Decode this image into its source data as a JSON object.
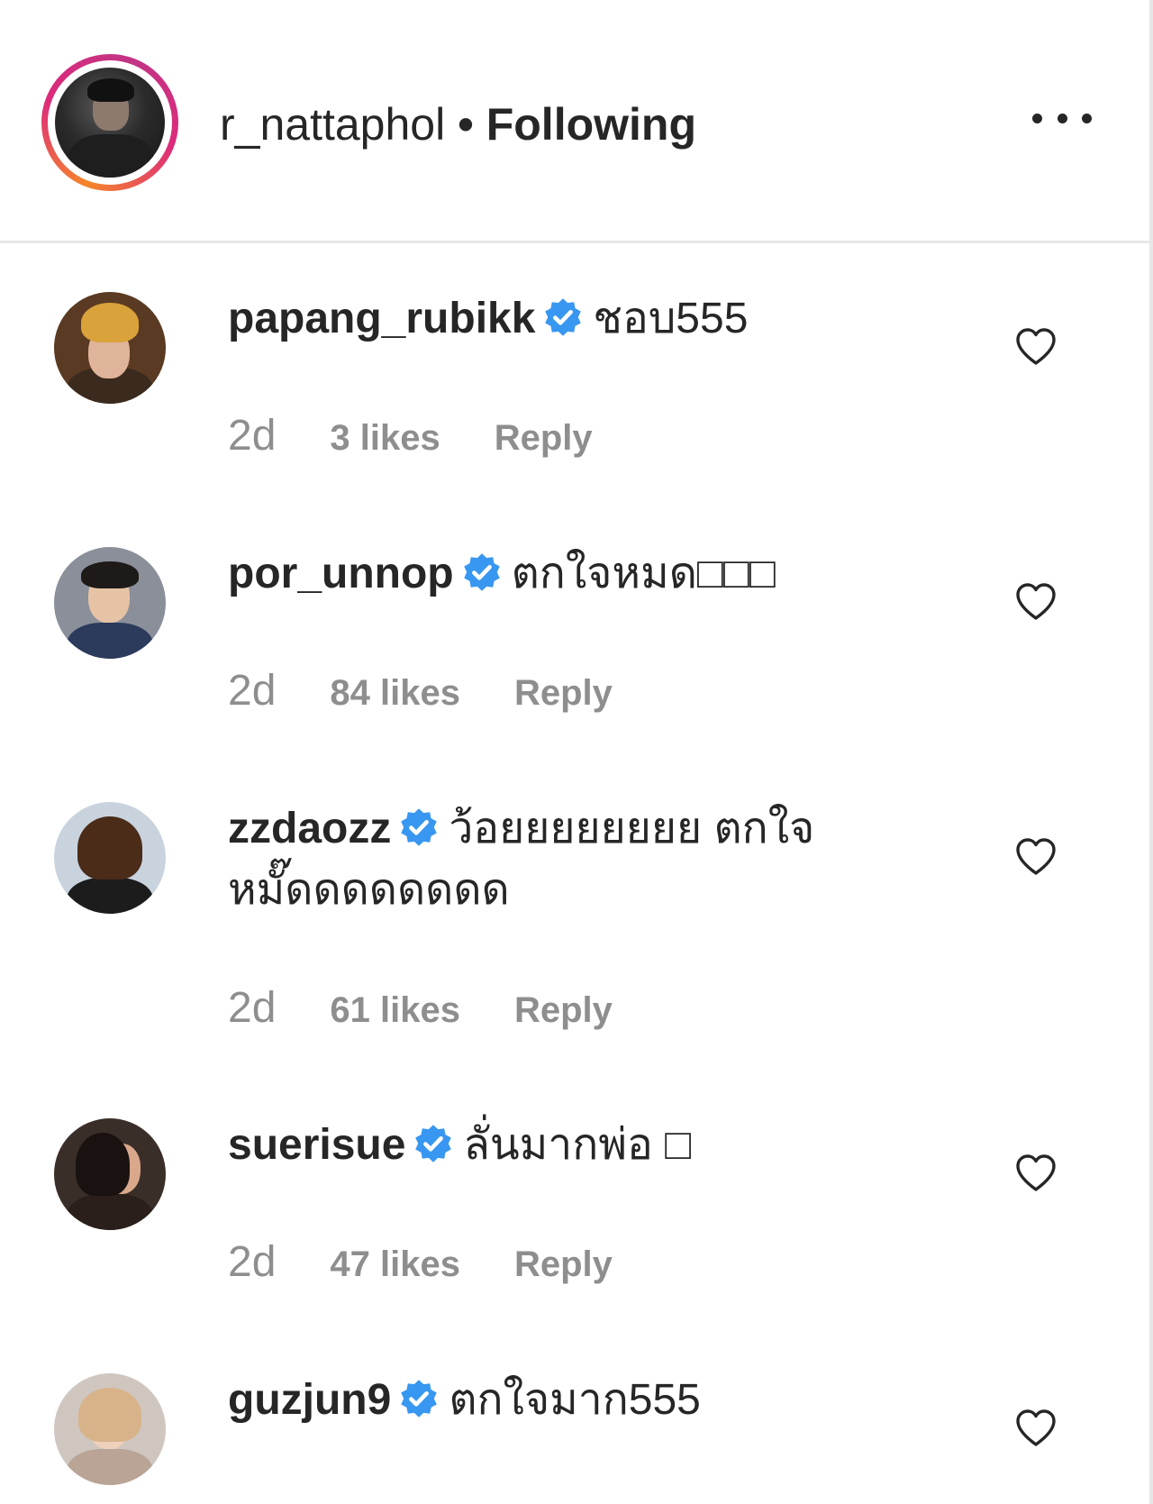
{
  "header": {
    "username": "r_nattaphol",
    "separator": "•",
    "follow_status": "Following",
    "more_icon": "more-horizontal-icon"
  },
  "comments": [
    {
      "username": "papang_rubikk",
      "verified": true,
      "text": "ชอบ555",
      "time": "2d",
      "likes": "3 likes",
      "reply": "Reply"
    },
    {
      "username": "por_unnop",
      "verified": true,
      "text": "ตกใจหมด□□□",
      "time": "2d",
      "likes": "84 likes",
      "reply": "Reply"
    },
    {
      "username": "zzdaozz",
      "verified": true,
      "text": "ว้อยยยยยยยย ตกใจหมั๊ดดดดดดดด",
      "time": "2d",
      "likes": "61 likes",
      "reply": "Reply"
    },
    {
      "username": "suerisue",
      "verified": true,
      "text": "ลั่นมากพ่อ □",
      "time": "2d",
      "likes": "47 likes",
      "reply": "Reply"
    },
    {
      "username": "guzjun9",
      "verified": true,
      "text": "ตกใจมาก555",
      "time": "",
      "likes": "",
      "reply": ""
    }
  ],
  "colors": {
    "text": "#262626",
    "meta": "#8e8e8e",
    "verified": "#3897f0",
    "divider": "#e8e8e8"
  }
}
